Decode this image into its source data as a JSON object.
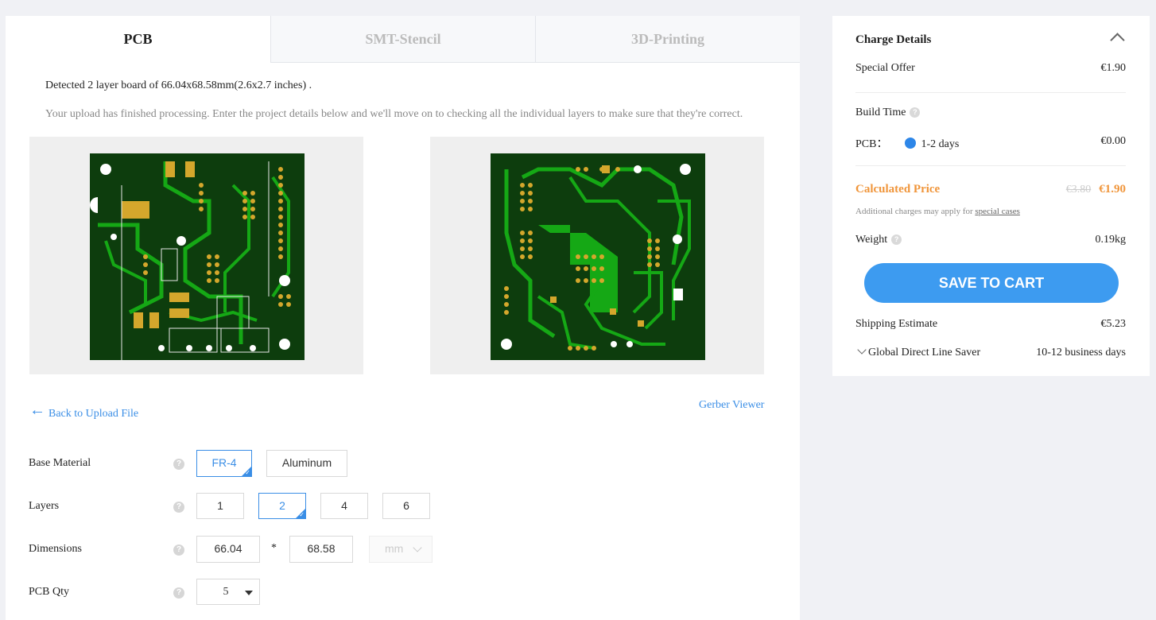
{
  "tabs": [
    {
      "label": "PCB",
      "active": true
    },
    {
      "label": "SMT-Stencil",
      "active": false
    },
    {
      "label": "3D-Printing",
      "active": false
    }
  ],
  "detected_text": "Detected 2 layer board of 66.04x68.58mm(2.6x2.7 inches) .",
  "description": "Your upload has finished processing. Enter the project details below and we'll move on to checking all the individual layers to make sure that they're correct.",
  "links": {
    "back": "Back to Upload File",
    "gerber": "Gerber Viewer"
  },
  "form": {
    "base_material": {
      "label": "Base Material",
      "options": [
        "FR-4",
        "Aluminum"
      ],
      "selected": "FR-4"
    },
    "layers": {
      "label": "Layers",
      "options": [
        "1",
        "2",
        "4",
        "6"
      ],
      "selected": "2"
    },
    "dimensions": {
      "label": "Dimensions",
      "width": "66.04",
      "separator": "*",
      "height": "68.58",
      "unit": "mm"
    },
    "pcb_qty": {
      "label": "PCB Qty",
      "value": "5"
    }
  },
  "help_glyph": "?",
  "charge": {
    "title": "Charge Details",
    "special_offer": {
      "label": "Special Offer",
      "value": "€1.90"
    },
    "build_time": {
      "label": "Build Time"
    },
    "pcb_build": {
      "label": "PCB：",
      "option": "1-2 days",
      "value": "€0.00"
    },
    "calculated_price": {
      "label": "Calculated Price",
      "old": "€3.80",
      "value": "€1.90"
    },
    "note": "Additional charges may apply for",
    "note_link": "special cases",
    "weight": {
      "label": "Weight",
      "value": "0.19kg"
    },
    "cart_button": "SAVE TO CART",
    "shipping": {
      "label": "Shipping Estimate",
      "value": "€5.23"
    },
    "shipping_method": {
      "label": "Global Direct Line Saver",
      "value": "10-12 business days"
    }
  },
  "colors": {
    "accent": "#3a8ee6",
    "price": "#f0953a",
    "board": "#0d3d0d",
    "trace": "#15a815",
    "pad": "#d4a72c"
  }
}
